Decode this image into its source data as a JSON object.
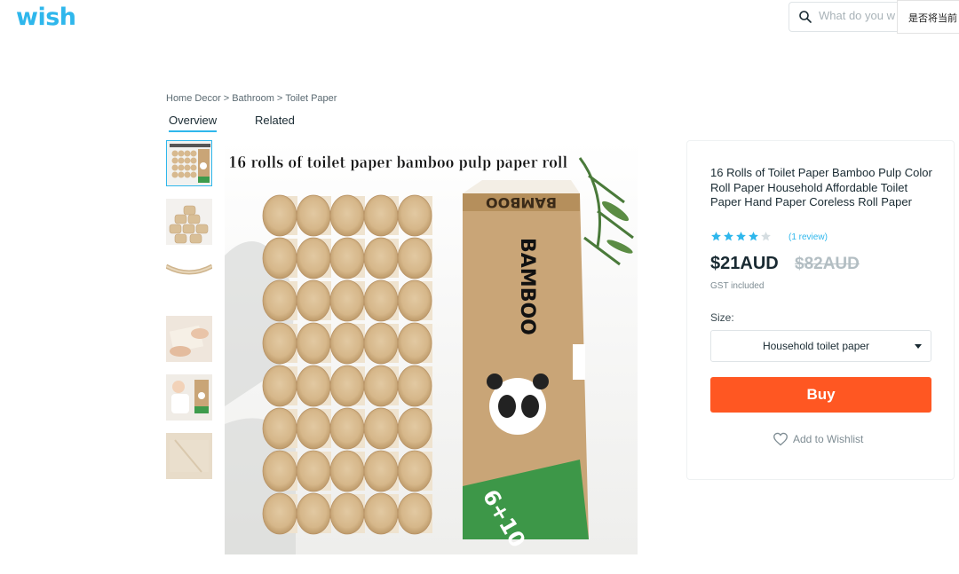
{
  "header": {
    "logo_text": "wish",
    "search_placeholder": "What do you w",
    "popup_text": "是否将当前"
  },
  "breadcrumb": {
    "items": [
      "Home Decor",
      "Bathroom",
      "Toilet Paper"
    ],
    "separator": ">"
  },
  "tabs": [
    {
      "label": "Overview",
      "active": true
    },
    {
      "label": "Related",
      "active": false
    }
  ],
  "product": {
    "image_caption": "16 rolls of toilet paper bamboo pulp paper roll",
    "package_brand": "BAMBOO",
    "package_count": "6+10",
    "title": "16 Rolls of Toilet Paper Bamboo Pulp Color Roll Paper Household Affordable Toilet Paper Hand Paper Coreless Roll Paper",
    "rating": 4,
    "rating_max": 5,
    "reviews_label": "(1 review)",
    "price": "$21AUD",
    "original_price": "$82AUD",
    "tax_note": "GST included",
    "size_label": "Size:",
    "size_selected": "Household toilet paper",
    "buy_label": "Buy",
    "wishlist_label": "Add to Wishlist"
  },
  "colors": {
    "brand": "#2fb7ec",
    "buy": "#ff5722",
    "star": "#2fb7ec",
    "star_empty": "#d5dde1"
  }
}
